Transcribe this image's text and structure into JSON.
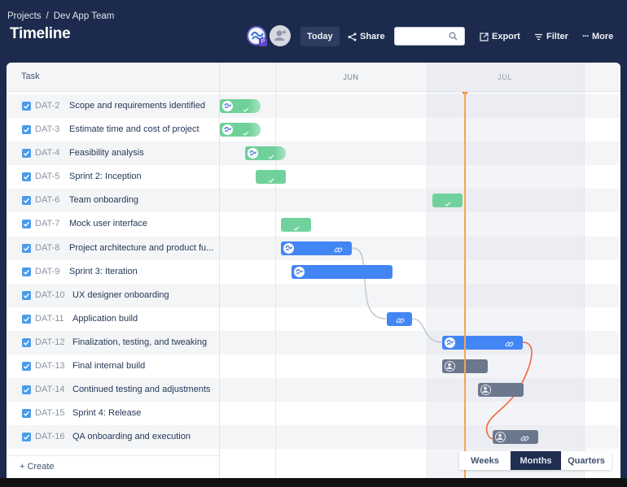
{
  "header": {
    "breadcrumb": [
      "Projects",
      "Dev App Team"
    ],
    "breadcrumb_separator": "/",
    "title": "Timeline",
    "project_badge": "P",
    "toolbar": {
      "today": "Today",
      "share": "Share",
      "search_placeholder": "",
      "export": "Export",
      "filter": "Filter",
      "more": "More"
    }
  },
  "timeline": {
    "task_column_header": "Task",
    "months": [
      "JUN",
      "JUL"
    ],
    "create_label": "+ Create",
    "zoom_options": [
      "Weeks",
      "Months",
      "Quarters"
    ],
    "zoom_selected": "Months",
    "colors": {
      "done": "#71d19c",
      "in_progress": "#4285f4",
      "todo": "#6b778c",
      "today_line": "#f2a657",
      "critical_dependency": "#ef6a3c"
    }
  },
  "tasks": [
    {
      "key": "DAT-2",
      "name": "Scope and requirements identified",
      "checked": true,
      "status": "done"
    },
    {
      "key": "DAT-3",
      "name": "Estimate time and cost of project",
      "checked": true,
      "status": "done"
    },
    {
      "key": "DAT-4",
      "name": "Feasibility analysis",
      "checked": true,
      "status": "done"
    },
    {
      "key": "DAT-5",
      "name": "Sprint 2: Inception",
      "checked": true,
      "status": "done"
    },
    {
      "key": "DAT-6",
      "name": "Team onboarding",
      "checked": true,
      "status": "done"
    },
    {
      "key": "DAT-7",
      "name": "Mock user interface",
      "checked": true,
      "status": "done"
    },
    {
      "key": "DAT-8",
      "name": "Project architecture and product fu...",
      "checked": true,
      "status": "in_progress"
    },
    {
      "key": "DAT-9",
      "name": "Sprint 3: Iteration",
      "checked": true,
      "status": "in_progress"
    },
    {
      "key": "DAT-10",
      "name": "UX designer onboarding",
      "checked": true,
      "status": "none"
    },
    {
      "key": "DAT-11",
      "name": "Application build",
      "checked": true,
      "status": "in_progress"
    },
    {
      "key": "DAT-12",
      "name": "Finalization, testing, and tweaking",
      "checked": true,
      "status": "in_progress"
    },
    {
      "key": "DAT-13",
      "name": "Final internal build",
      "checked": true,
      "status": "todo"
    },
    {
      "key": "DAT-14",
      "name": "Continued testing and adjustments",
      "checked": true,
      "status": "todo"
    },
    {
      "key": "DAT-15",
      "name": "Sprint 4: Release",
      "checked": true,
      "status": "none"
    },
    {
      "key": "DAT-16",
      "name": "QA onboarding and execution",
      "checked": true,
      "status": "todo"
    }
  ]
}
